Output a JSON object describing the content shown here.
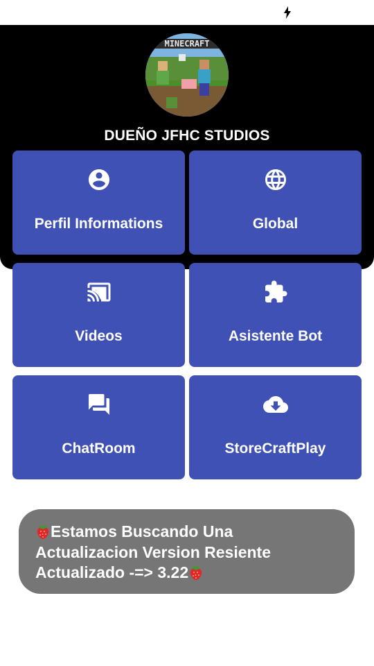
{
  "header": {
    "owner_title": "DUEÑO JFHC STUDIOS",
    "avatar_logo_text": "MINECRAFT"
  },
  "menu": {
    "tiles": [
      {
        "label": "Perfil Informations",
        "icon": "account-circle-icon"
      },
      {
        "label": "Global",
        "icon": "globe-icon"
      },
      {
        "label": "Videos",
        "icon": "cast-icon"
      },
      {
        "label": "Asistente Bot",
        "icon": "puzzle-icon"
      },
      {
        "label": "ChatRoom",
        "icon": "chat-icon"
      },
      {
        "label": "StoreCraftPlay",
        "icon": "cloud-download-icon"
      }
    ]
  },
  "banner": {
    "line1": "Estamos Buscando Una",
    "line2": "Actualizacion Version Resiente",
    "line3": "Actualizado -=> 3.22",
    "emoji": "strawberry-icon"
  },
  "colors": {
    "tile": "#3f51b5",
    "header": "#000000",
    "banner": "#767676"
  }
}
